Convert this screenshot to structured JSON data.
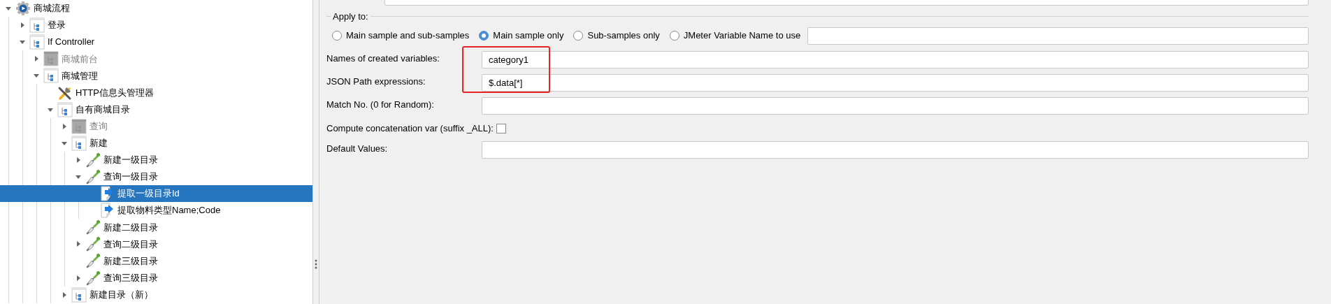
{
  "tree": [
    {
      "label": "商城流程",
      "kind": "gear",
      "expanded": true,
      "disabled": false,
      "selected": false,
      "children": [
        {
          "label": "登录",
          "kind": "controller",
          "expanded": false,
          "disabled": false,
          "selected": false
        },
        {
          "label": "If Controller",
          "kind": "controller",
          "expanded": true,
          "disabled": false,
          "selected": false,
          "children": [
            {
              "label": "商城前台",
              "kind": "controller",
              "expanded": false,
              "disabled": true,
              "selected": false
            },
            {
              "label": "商城管理",
              "kind": "controller",
              "expanded": true,
              "disabled": false,
              "selected": false,
              "children": [
                {
                  "label": "HTTP信息头管理器",
                  "kind": "tools",
                  "disabled": false,
                  "selected": false
                },
                {
                  "label": "自有商城目录",
                  "kind": "controller",
                  "expanded": true,
                  "disabled": false,
                  "selected": false,
                  "children": [
                    {
                      "label": "查询",
                      "kind": "controller",
                      "expanded": false,
                      "disabled": true,
                      "selected": false
                    },
                    {
                      "label": "新建",
                      "kind": "controller",
                      "expanded": true,
                      "disabled": false,
                      "selected": false,
                      "children": [
                        {
                          "label": "新建一级目录",
                          "kind": "sampler",
                          "expanded": false,
                          "disabled": false,
                          "selected": false
                        },
                        {
                          "label": "查询一级目录",
                          "kind": "sampler",
                          "expanded": true,
                          "disabled": false,
                          "selected": false,
                          "children": [
                            {
                              "label": "提取一级目录Id",
                              "kind": "extractor",
                              "disabled": false,
                              "selected": true
                            },
                            {
                              "label": "提取物料类型Name;Code",
                              "kind": "extractor",
                              "disabled": false,
                              "selected": false
                            }
                          ]
                        },
                        {
                          "label": "新建二级目录",
                          "kind": "sampler",
                          "disabled": false,
                          "selected": false
                        },
                        {
                          "label": "查询二级目录",
                          "kind": "sampler",
                          "expanded": false,
                          "disabled": false,
                          "selected": false
                        },
                        {
                          "label": "新建三级目录",
                          "kind": "sampler",
                          "disabled": false,
                          "selected": false
                        },
                        {
                          "label": "查询三级目录",
                          "kind": "sampler",
                          "expanded": false,
                          "disabled": false,
                          "selected": false
                        }
                      ]
                    },
                    {
                      "label": "新建目录（新）",
                      "kind": "controller",
                      "expanded": false,
                      "disabled": false,
                      "selected": false
                    }
                  ]
                }
              ]
            }
          ]
        }
      ]
    }
  ],
  "form": {
    "apply_to": {
      "legend": "Apply to:",
      "options": [
        {
          "label": "Main sample and sub-samples",
          "selected": false
        },
        {
          "label": "Main sample only",
          "selected": true
        },
        {
          "label": "Sub-samples only",
          "selected": false
        },
        {
          "label": "JMeter Variable Name to use",
          "selected": false
        }
      ]
    },
    "fields": [
      {
        "label": "Names of created variables:",
        "kind": "text",
        "value": "category1",
        "highlighted": true
      },
      {
        "label": "JSON Path expressions:",
        "kind": "text",
        "value": "$.data[*]",
        "highlighted": true
      },
      {
        "label": "Match No. (0 for Random):",
        "kind": "text",
        "highlighted": false
      },
      {
        "label": "Compute concatenation var (suffix _ALL):",
        "kind": "checkbox",
        "checked": false,
        "highlighted": false
      },
      {
        "label": "Default Values:",
        "kind": "text",
        "highlighted": false
      }
    ]
  }
}
